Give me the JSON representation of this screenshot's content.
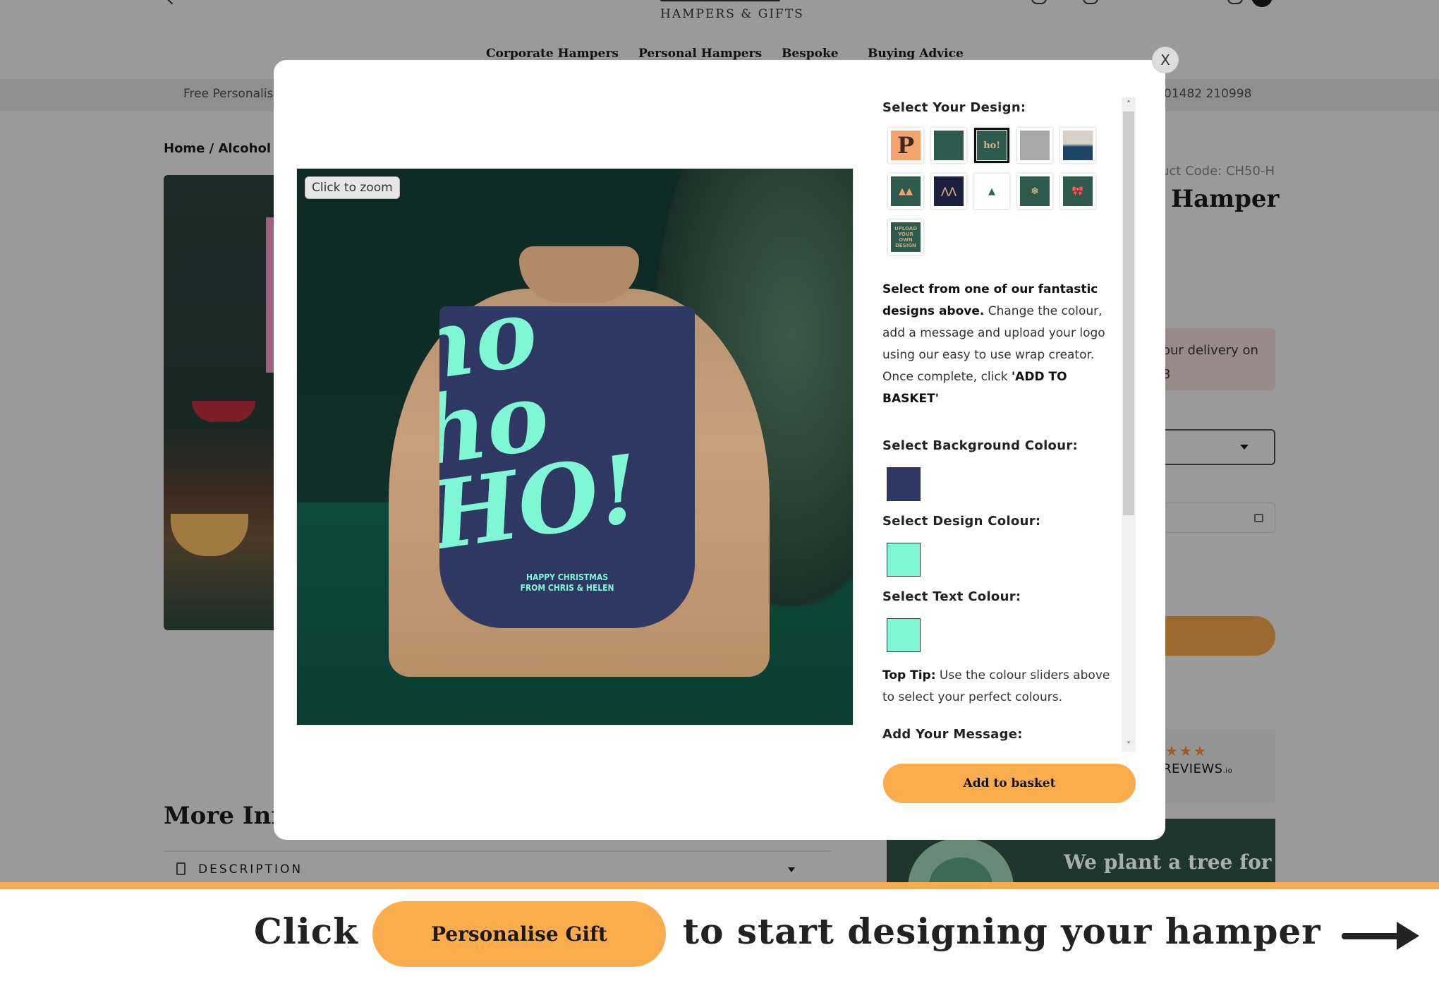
{
  "header": {
    "logo_subtitle": "HAMPERS & GIFTS",
    "nav": [
      "Corporate Hampers",
      "Personal Hampers",
      "Bespoke",
      "Buying Advice"
    ]
  },
  "strip": {
    "left_text": "Free Personalis",
    "phone": "01482 210998"
  },
  "breadcrumb": "Home / Alcohol F",
  "product": {
    "code": "uct Code: CH50-H",
    "title": "Hamper",
    "delivery_line1": "our delivery on",
    "delivery_line2": "3",
    "reviews_stars": "★★★",
    "reviews_brand": "REVIEWS",
    "reviews_suffix": ".io",
    "tree_text": "We plant a tree for"
  },
  "more_info": {
    "heading": "More Info",
    "description_label": "DESCRIPTION"
  },
  "modal": {
    "close_label": "X",
    "zoom_label": "Click to zoom",
    "image": {
      "flap_text": "ho ho HO!",
      "flap_message_line1": "HAPPY CHRISTMAS",
      "flap_message_line2": "FROM CHRIS & HELEN"
    },
    "select_design_label": "Select Your Design:",
    "designs": [
      {
        "name": "letter-p",
        "glyph": "P",
        "bg": "#f4a46c",
        "fg": "#3a2a20",
        "selected": false
      },
      {
        "name": "plain-green",
        "glyph": "",
        "bg": "#2d5a4c",
        "fg": "#2d5a4c",
        "selected": false
      },
      {
        "name": "ho-ho-ho",
        "glyph": "ho!",
        "bg": "#2d5a4c",
        "fg": "#d4b884",
        "selected": true
      },
      {
        "name": "snowy-branches",
        "glyph": "",
        "bg": "#a8a8a8",
        "fg": "#ffffff",
        "selected": false
      },
      {
        "name": "torn-paper",
        "glyph": "",
        "bg": "#1b4466",
        "fg": "#d8d0c4",
        "selected": false
      },
      {
        "name": "trees",
        "glyph": "▲▲",
        "bg": "#2d5a4c",
        "fg": "#f4a46c",
        "selected": false
      },
      {
        "name": "navy-pattern",
        "glyph": "⋀⋀",
        "bg": "#1b2040",
        "fg": "#c8a878",
        "selected": false
      },
      {
        "name": "merry-christmas",
        "glyph": "▲",
        "bg": "#ffffff",
        "fg": "#2d6a50",
        "selected": false
      },
      {
        "name": "snowflakes",
        "glyph": "❄",
        "bg": "#2d5a4c",
        "fg": "#c8a878",
        "selected": false
      },
      {
        "name": "red-bow",
        "glyph": "🎀",
        "bg": "#2d5a4c",
        "fg": "#c0282c",
        "selected": false
      },
      {
        "name": "upload-own",
        "glyph": "UPLOAD YOUR OWN DESIGN",
        "bg": "#2d5a4c",
        "fg": "#c8a878",
        "selected": false
      }
    ],
    "intro_bold": "Select from one of our fantastic designs above.",
    "intro_text": " Change the colour, add a message and upload your logo using our easy to use wrap creator. Once complete, click ",
    "intro_cta": "'ADD TO BASKET'",
    "background_colour_label": "Select Background Colour:",
    "background_colour": "#2f3862",
    "design_colour_label": "Select Design Colour:",
    "design_colour": "#7ff7d4",
    "text_colour_label": "Select Text Colour:",
    "text_colour": "#7ff7d4",
    "tip_bold": "Top Tip:",
    "tip_text": " Use the colour sliders above to select your perfect colours.",
    "message_label": "Add Your Message:",
    "message_value": "Happy Christmas",
    "add_to_basket_label": "Add to basket"
  },
  "banner": {
    "word_click": "Click",
    "button_label": "Personalise Gift",
    "rest": "to start designing your hamper"
  },
  "colors": {
    "accent_orange": "#fbad4d",
    "overlay_gray": "#9a9a9a"
  }
}
